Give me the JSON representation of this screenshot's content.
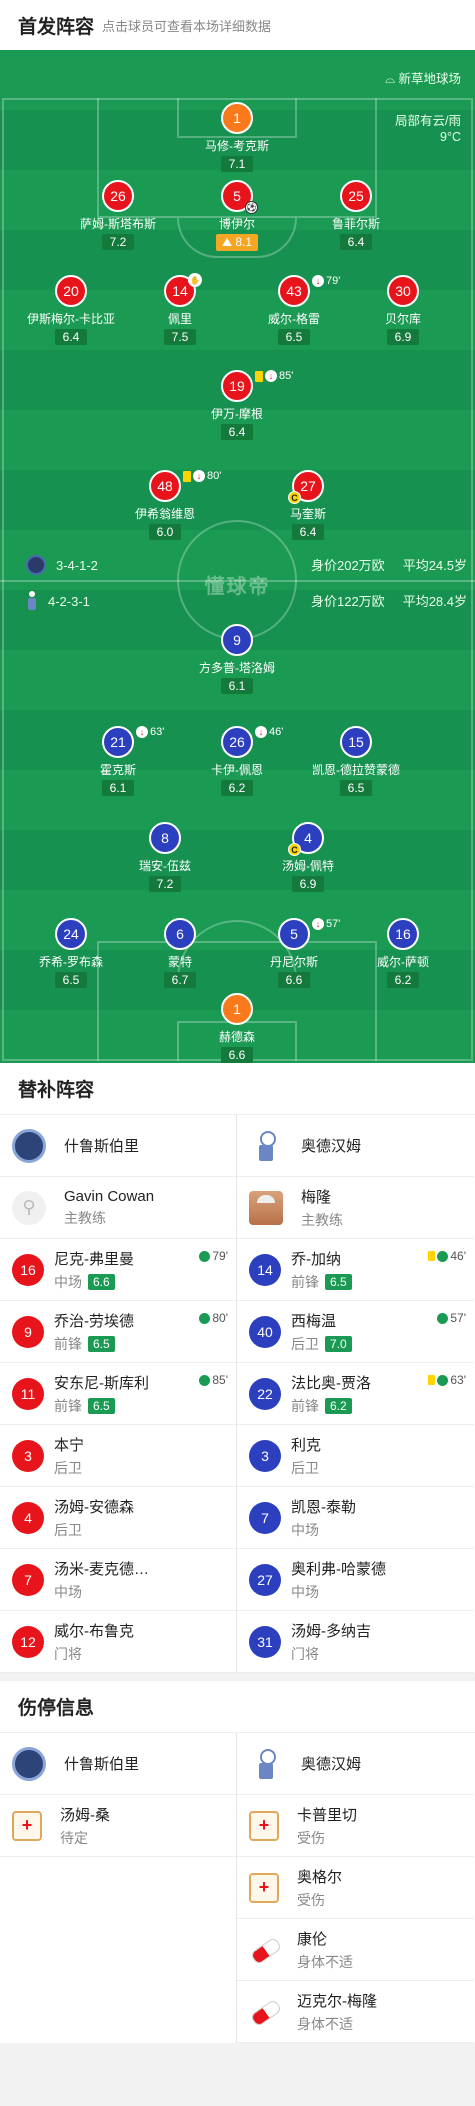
{
  "header": {
    "title": "首发阵容",
    "subtitle": "点击球员可查看本场详细数据"
  },
  "pitch": {
    "venue": "新草地球场",
    "weather": "局部有云/雨",
    "temp": "9°C",
    "watermark": "懂球帝",
    "home": {
      "formation": "3-4-1-2",
      "value": "身价202万欧",
      "age": "平均24.5岁"
    },
    "away": {
      "formation": "4-2-3-1",
      "value": "身价122万欧",
      "age": "平均28.4岁"
    }
  },
  "home_players": [
    {
      "num": "1",
      "name": "马修-考克斯",
      "rating": "7.1"
    },
    {
      "num": "26",
      "name": "萨姆-斯塔布斯",
      "rating": "7.2"
    },
    {
      "num": "5",
      "name": "博伊尔",
      "rating": "8.1"
    },
    {
      "num": "25",
      "name": "鲁菲尔斯",
      "rating": "6.4"
    },
    {
      "num": "20",
      "name": "伊斯梅尔-卡比亚",
      "rating": "6.4"
    },
    {
      "num": "14",
      "name": "佩里",
      "rating": "7.5"
    },
    {
      "num": "43",
      "name": "威尔-格雷",
      "rating": "6.5",
      "sub": "79'"
    },
    {
      "num": "30",
      "name": "贝尔库",
      "rating": "6.9"
    },
    {
      "num": "19",
      "name": "伊万-摩根",
      "rating": "6.4",
      "sub": "85'"
    },
    {
      "num": "48",
      "name": "伊希翁维恩",
      "rating": "6.0",
      "sub": "80'"
    },
    {
      "num": "27",
      "name": "马奎斯",
      "rating": "6.4"
    }
  ],
  "away_players": [
    {
      "num": "9",
      "name": "方多普-塔洛姆",
      "rating": "6.1"
    },
    {
      "num": "21",
      "name": "霍克斯",
      "rating": "6.1",
      "sub": "63'"
    },
    {
      "num": "26",
      "name": "卡伊-佩恩",
      "rating": "6.2",
      "sub": "46'"
    },
    {
      "num": "15",
      "name": "凯恩-德拉赞蒙德",
      "rating": "6.5"
    },
    {
      "num": "8",
      "name": "瑞安-伍兹",
      "rating": "7.2"
    },
    {
      "num": "4",
      "name": "汤姆-佩特",
      "rating": "6.9"
    },
    {
      "num": "24",
      "name": "乔希-罗布森",
      "rating": "6.5"
    },
    {
      "num": "6",
      "name": "蒙特",
      "rating": "6.7"
    },
    {
      "num": "5",
      "name": "丹尼尔斯",
      "rating": "6.6",
      "sub": "57'"
    },
    {
      "num": "16",
      "name": "威尔-萨顿",
      "rating": "6.2"
    },
    {
      "num": "1",
      "name": "赫德森",
      "rating": "6.6"
    }
  ],
  "subs": {
    "title": "替补阵容",
    "home_team": "什鲁斯伯里",
    "away_team": "奥德汉姆",
    "home_coach": {
      "name": "Gavin Cowan",
      "role": "主教练"
    },
    "away_coach": {
      "name": "梅隆",
      "role": "主教练"
    },
    "home": [
      {
        "num": "16",
        "name": "尼克-弗里曼",
        "pos": "中场",
        "rating": "6.6",
        "ev": "79'"
      },
      {
        "num": "9",
        "name": "乔治-劳埃德",
        "pos": "前锋",
        "rating": "6.5",
        "ev": "80'"
      },
      {
        "num": "11",
        "name": "安东尼-斯库利",
        "pos": "前锋",
        "rating": "6.5",
        "ev": "85'"
      },
      {
        "num": "3",
        "name": "本宁",
        "pos": "后卫"
      },
      {
        "num": "4",
        "name": "汤姆-安德森",
        "pos": "后卫"
      },
      {
        "num": "7",
        "name": "汤米-麦克德…",
        "pos": "中场"
      },
      {
        "num": "12",
        "name": "威尔-布鲁克",
        "pos": "门将"
      }
    ],
    "away": [
      {
        "num": "14",
        "name": "乔-加纳",
        "pos": "前锋",
        "rating": "6.5",
        "ev": "46'",
        "card": true
      },
      {
        "num": "40",
        "name": "西梅温",
        "pos": "后卫",
        "rating": "7.0",
        "ev": "57'"
      },
      {
        "num": "22",
        "name": "法比奥-贾洛",
        "pos": "前锋",
        "rating": "6.2",
        "ev": "63'",
        "card": true
      },
      {
        "num": "3",
        "name": "利克",
        "pos": "后卫"
      },
      {
        "num": "7",
        "name": "凯恩-泰勒",
        "pos": "中场"
      },
      {
        "num": "27",
        "name": "奥利弗-哈蒙德",
        "pos": "中场"
      },
      {
        "num": "31",
        "name": "汤姆-多纳吉",
        "pos": "门将"
      }
    ]
  },
  "injuries": {
    "title": "伤停信息",
    "home_team": "什鲁斯伯里",
    "away_team": "奥德汉姆",
    "home": [
      {
        "name": "汤姆-桑",
        "status": "待定",
        "icon": "first-aid-icon"
      }
    ],
    "away": [
      {
        "name": "卡普里切",
        "status": "受伤",
        "icon": "first-aid-icon"
      },
      {
        "name": "奥格尔",
        "status": "受伤",
        "icon": "first-aid-icon"
      },
      {
        "name": "康伦",
        "status": "身体不适",
        "icon": "pill-icon"
      },
      {
        "name": "迈克尔-梅隆",
        "status": "身体不适",
        "icon": "pill-icon"
      }
    ]
  }
}
